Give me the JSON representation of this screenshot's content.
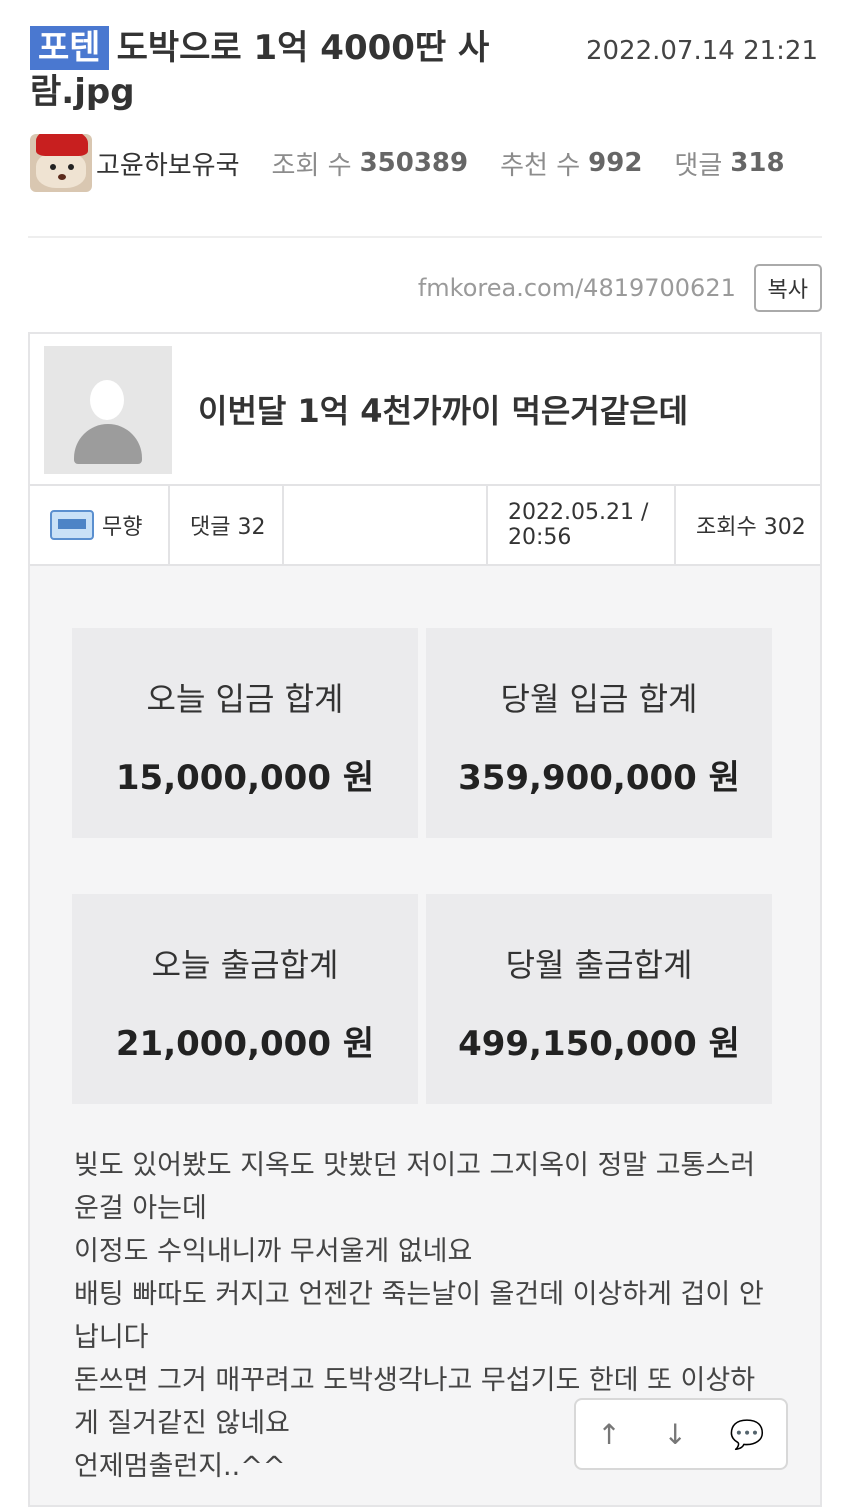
{
  "header": {
    "badge": "포텐",
    "title": "도박으로 1억 4000딴 사람.jpg",
    "date": "2022.07.14 21:21"
  },
  "meta": {
    "author": "고윤하보유국",
    "views_label": "조회 수",
    "views": "350389",
    "recommend_label": "추천 수",
    "recommend": "992",
    "comments_label": "댓글",
    "comments": "318"
  },
  "url_row": {
    "url": "fmkorea.com/4819700621",
    "copy_label": "복사"
  },
  "embedded_post": {
    "title": "이번달 1억 4천가까이 먹은거같은데",
    "author": "무향",
    "comments": "댓글 32",
    "datetime": "2022.05.21 / 20:56",
    "views": "조회수 302",
    "stats": [
      {
        "label": "오늘 입금 합계",
        "value": "15,000,000 원"
      },
      {
        "label": "당월 입금 합계",
        "value": "359,900,000 원"
      },
      {
        "label": "오늘 출금합계",
        "value": "21,000,000 원"
      },
      {
        "label": "당월 출금합계",
        "value": "499,150,000 원"
      }
    ],
    "body_lines": [
      "빚도 있어봤도 지옥도 맛봤던 저이고 그지옥이 정말 고통스러",
      "운걸 아는데",
      "이정도 수익내니까 무서울게 없네요",
      "배팅 빠따도 커지고 언젠간 죽는날이 올건데 이상하게 겁이 안",
      "납니다",
      "돈쓰면 그거 매꾸려고 도박생각나고 무섭기도 한데 또 이상하",
      "게 질거같진 않네요",
      "언제멈출런지..^^"
    ]
  },
  "actions": {
    "up_icon": "↑",
    "down_icon": "↓",
    "comment_icon": "💬"
  }
}
